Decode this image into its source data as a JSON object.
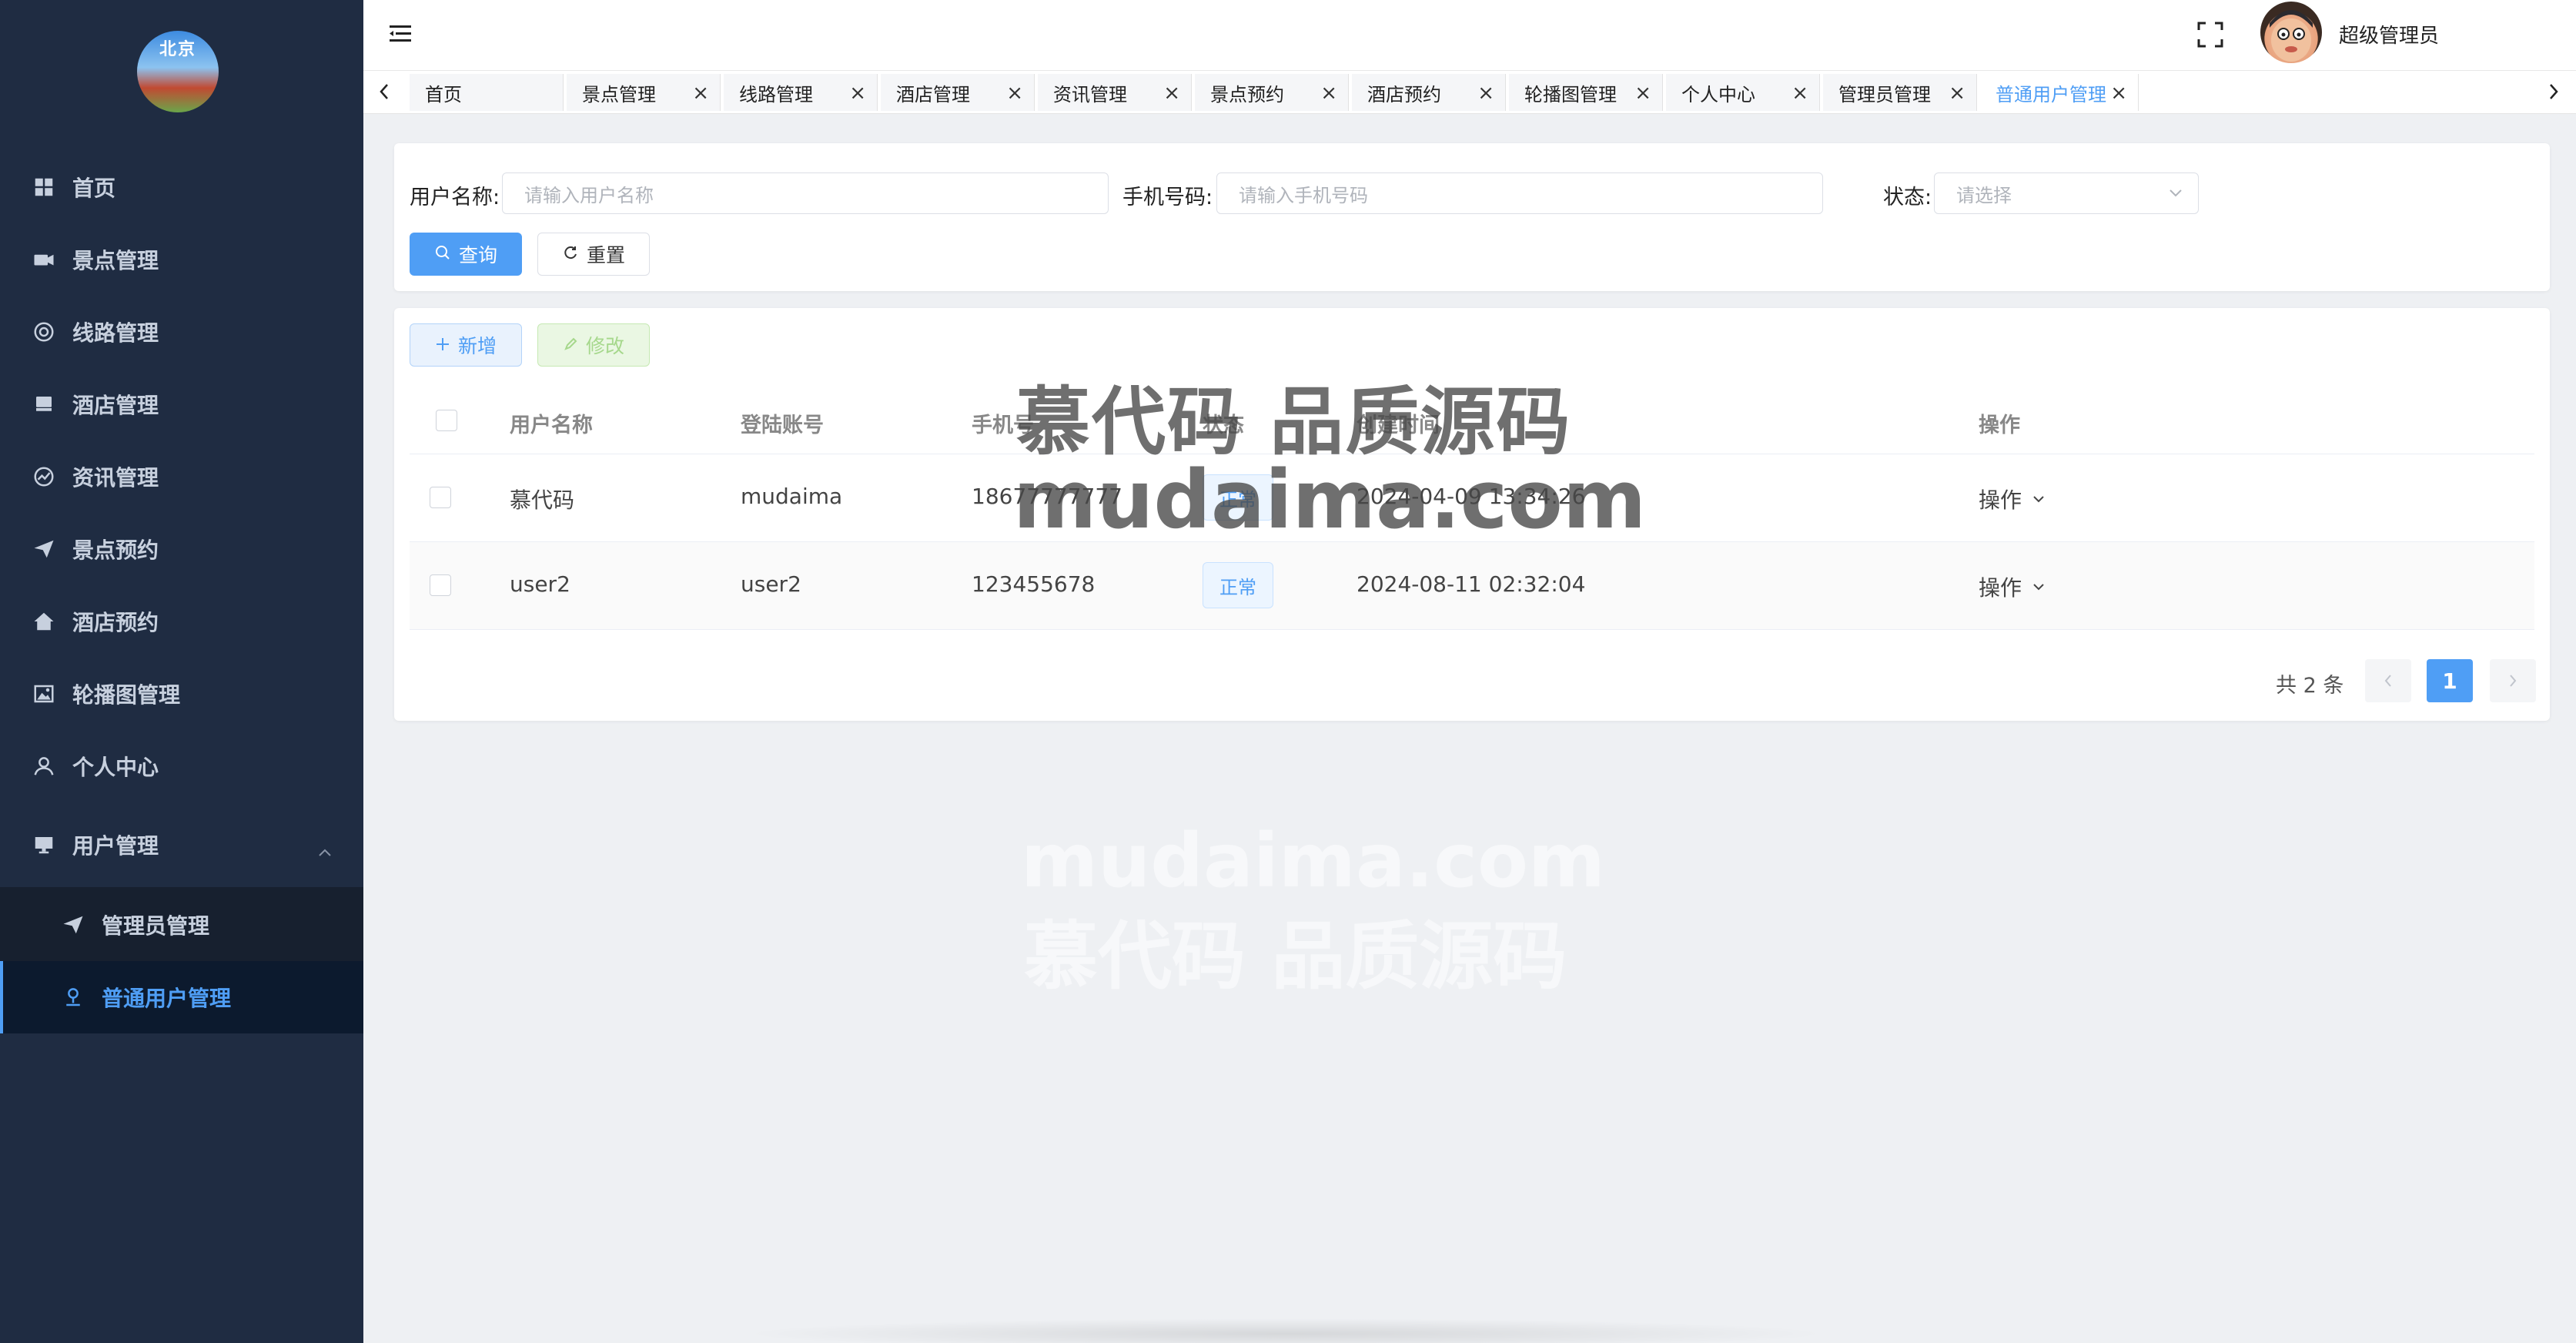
{
  "sidebar": {
    "logo_text": "北京",
    "items": [
      {
        "label": "首页",
        "icon": "grid-icon"
      },
      {
        "label": "景点管理",
        "icon": "camera-icon"
      },
      {
        "label": "线路管理",
        "icon": "ring-icon"
      },
      {
        "label": "酒店管理",
        "icon": "bed-icon"
      },
      {
        "label": "资讯管理",
        "icon": "chart-circle-icon"
      },
      {
        "label": "景点预约",
        "icon": "paper-plane-icon"
      },
      {
        "label": "酒店预约",
        "icon": "home-icon"
      },
      {
        "label": "轮播图管理",
        "icon": "picture-icon"
      },
      {
        "label": "个人中心",
        "icon": "user-icon"
      },
      {
        "label": "用户管理",
        "icon": "monitor-icon"
      }
    ],
    "submenu": [
      {
        "label": "管理员管理",
        "icon": "paper-plane-icon"
      },
      {
        "label": "普通用户管理",
        "icon": "user-stamp-icon"
      }
    ]
  },
  "header": {
    "admin_name": "超级管理员"
  },
  "tags": [
    {
      "label": "首页",
      "closable": false
    },
    {
      "label": "景点管理",
      "closable": true
    },
    {
      "label": "线路管理",
      "closable": true
    },
    {
      "label": "酒店管理",
      "closable": true
    },
    {
      "label": "资讯管理",
      "closable": true
    },
    {
      "label": "景点预约",
      "closable": true
    },
    {
      "label": "酒店预约",
      "closable": true
    },
    {
      "label": "轮播图管理",
      "closable": true
    },
    {
      "label": "个人中心",
      "closable": true
    },
    {
      "label": "管理员管理",
      "closable": true
    },
    {
      "label": "普通用户管理",
      "closable": true,
      "active": true
    }
  ],
  "search": {
    "username_label": "用户名称:",
    "username_placeholder": "请输入用户名称",
    "phone_label": "手机号码:",
    "phone_placeholder": "请输入手机号码",
    "status_label": "状态:",
    "status_placeholder": "请选择",
    "query_button": "查询",
    "reset_button": "重置"
  },
  "toolbar": {
    "add_button": "新增",
    "edit_button": "修改"
  },
  "table": {
    "columns": [
      "用户名称",
      "登陆账号",
      "手机号",
      "状态",
      "创建时间",
      "操作"
    ],
    "rows": [
      {
        "username": "慕代码",
        "account": "mudaima",
        "phone": "18677777777",
        "status": "正常",
        "created": "2024-04-09 13:34:26",
        "action": "操作"
      },
      {
        "username": "user2",
        "account": "user2",
        "phone": "123455678",
        "status": "正常",
        "created": "2024-08-11 02:32:04",
        "action": "操作"
      }
    ]
  },
  "pagination": {
    "total_text": "共 2 条",
    "current_page": "1"
  },
  "watermark": {
    "line1": "慕代码 品质源码",
    "line2": "mudaima.com"
  },
  "colors": {
    "sidebar_bg": "#1f2c42",
    "accent": "#4f9ef5",
    "page_bg": "#eef0f3"
  }
}
